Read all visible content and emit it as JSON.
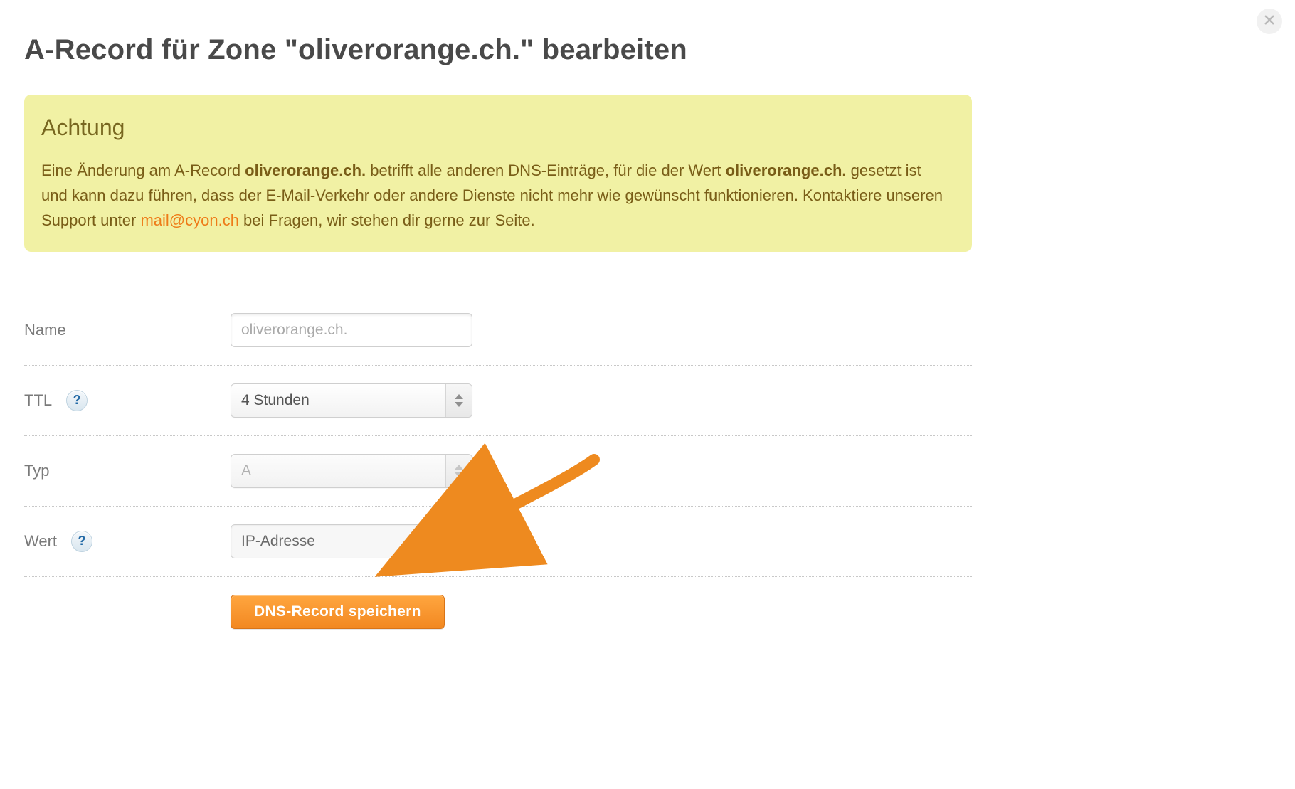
{
  "modal": {
    "title": "A-Record für Zone \"oliverorange.ch.\" bearbeiten"
  },
  "alert": {
    "heading": "Achtung",
    "text_1": "Eine Änderung am A-Record ",
    "bold_1": "oliverorange.ch.",
    "text_2": " betrifft alle anderen DNS-Einträge, für die der Wert ",
    "bold_2": "oliverorange.ch.",
    "text_3": " gesetzt ist und kann dazu führen, dass der E-Mail-Verkehr oder andere Dienste nicht mehr wie gewünscht funktionieren. Kontaktiere unseren Support unter ",
    "link_text": "mail@cyon.ch",
    "text_4": " bei Fragen, wir stehen dir gerne zur Seite."
  },
  "form": {
    "name_label": "Name",
    "name_placeholder": "oliverorange.ch.",
    "ttl_label": "TTL",
    "ttl_value": "4 Stunden",
    "typ_label": "Typ",
    "typ_value": "A",
    "wert_label": "Wert",
    "wert_value": "IP-Adresse",
    "help_symbol": "?",
    "save_label": "DNS-Record speichern"
  },
  "colors": {
    "accent": "#ee7b18",
    "alert_bg": "#f1f1a4",
    "alert_text": "#795d17"
  }
}
